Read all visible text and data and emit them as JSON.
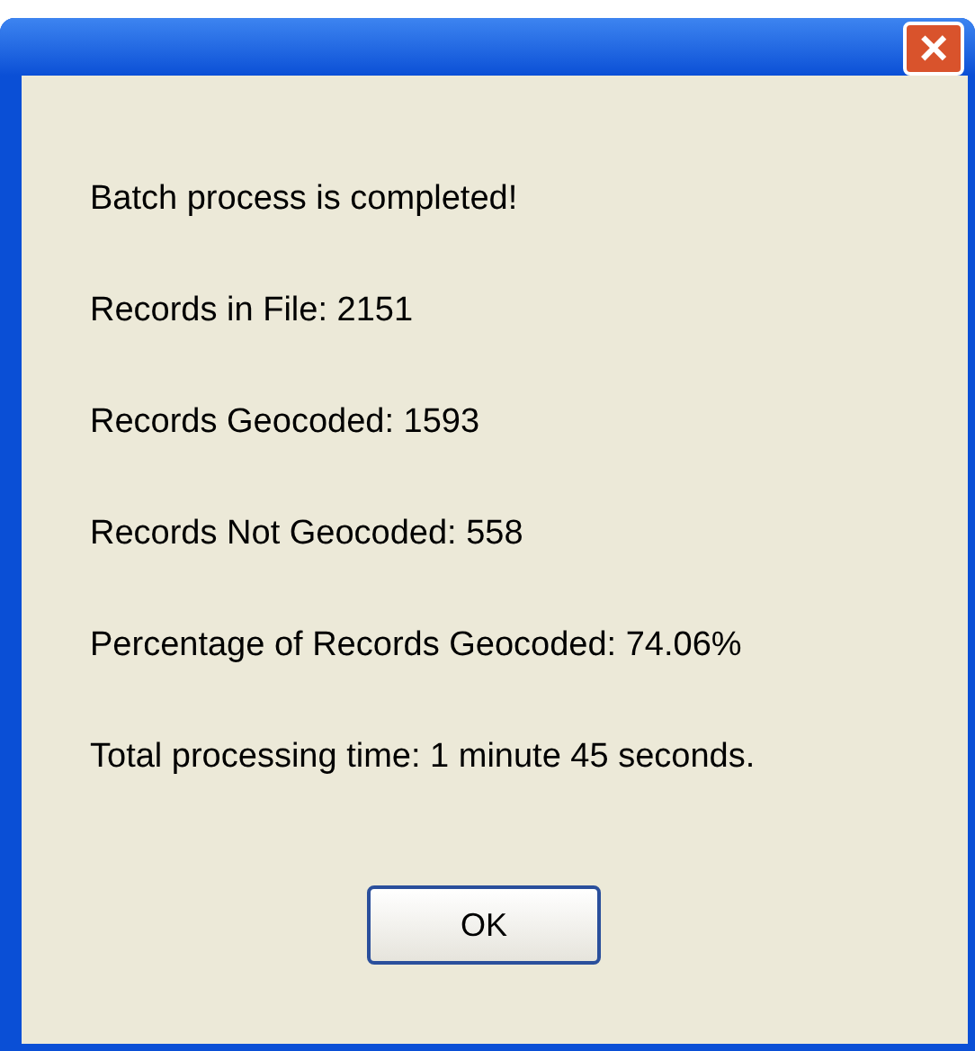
{
  "window": {
    "close_button": "×"
  },
  "messages": [
    "Batch process is completed!",
    "Records in File: 2151",
    "Records Geocoded: 1593",
    "Records Not Geocoded: 558",
    "Percentage of Records Geocoded: 74.06%",
    "Total processing time: 1 minute 45 seconds."
  ],
  "buttons": [
    "OK"
  ]
}
